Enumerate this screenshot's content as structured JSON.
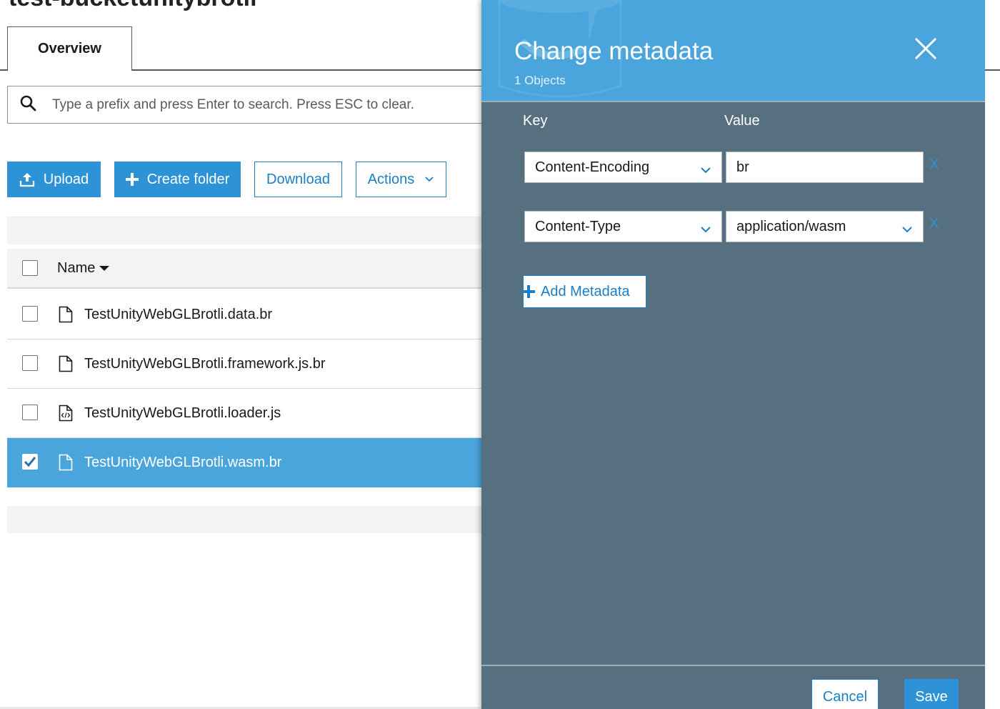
{
  "bucket": {
    "title": "test-bucketunitybrotli"
  },
  "tabs": [
    {
      "label": "Overview",
      "active": true
    }
  ],
  "search": {
    "placeholder": "Type a prefix and press Enter to search. Press ESC to clear.",
    "value": ""
  },
  "toolbar": {
    "upload_label": "Upload",
    "create_folder_label": "Create folder",
    "download_label": "Download",
    "actions_label": "Actions"
  },
  "table": {
    "header_name": "Name",
    "rows": [
      {
        "name": "TestUnityWebGLBrotli.data.br",
        "icon": "file-icon",
        "selected": false
      },
      {
        "name": "TestUnityWebGLBrotli.framework.js.br",
        "icon": "file-icon",
        "selected": false
      },
      {
        "name": "TestUnityWebGLBrotli.loader.js",
        "icon": "code-file-icon",
        "selected": false
      },
      {
        "name": "TestUnityWebGLBrotli.wasm.br",
        "icon": "file-icon",
        "selected": true
      }
    ]
  },
  "modal": {
    "title": "Change metadata",
    "subtitle": "1 Objects",
    "key_header": "Key",
    "value_header": "Value",
    "entries": [
      {
        "key": "Content-Encoding",
        "value": "br",
        "value_is_dropdown": false,
        "remove_label": "X"
      },
      {
        "key": "Content-Type",
        "value": "application/wasm",
        "value_is_dropdown": true,
        "remove_label": "X"
      }
    ],
    "add_label": "Add Metadata",
    "cancel_label": "Cancel",
    "save_label": "Save"
  },
  "colors": {
    "accent": "#2e92d6",
    "header_blue": "#4aa5dc",
    "panel_slate": "#56707f",
    "selected_row": "#4aa5dc"
  }
}
